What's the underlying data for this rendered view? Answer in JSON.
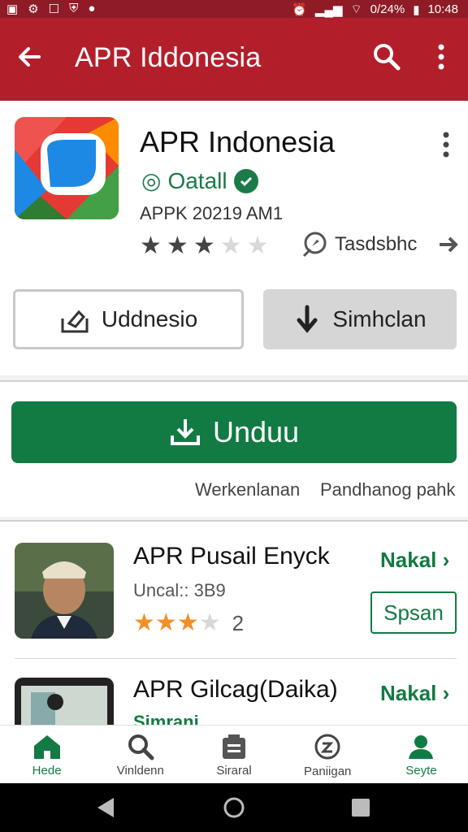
{
  "status_bar": {
    "time": "10:48",
    "battery": "0/24%"
  },
  "app_bar": {
    "title": "APR Iddonesia"
  },
  "app_card": {
    "name": "APR Indonesia",
    "developer": "Oatall",
    "meta": "APPK 20219 AM1",
    "rating": 3,
    "rating_max": 5,
    "tag_label": "Tasdsbhc",
    "button_outline": "Uddnesio",
    "button_grey": "Simhclan"
  },
  "install": {
    "label": "Unduu",
    "link_left": "Werkenlanan",
    "link_right": "Pandhanog pahk"
  },
  "list": [
    {
      "title": "APR Pusail Enyck",
      "action": "Nakal",
      "sub": "Uncal:: 3B9",
      "rating": 3,
      "count": "2",
      "button": "Spsan"
    },
    {
      "title": "APR Gilcag(Daika)",
      "action": "Nakal",
      "sub": "Simrani"
    }
  ],
  "bottom_nav": [
    {
      "label": "Hede",
      "icon": "home-icon",
      "active": true
    },
    {
      "label": "Vinldenn",
      "icon": "search-icon",
      "active": false
    },
    {
      "label": "Siraral",
      "icon": "apps-icon",
      "active": false
    },
    {
      "label": "Paniigan",
      "icon": "refresh-icon",
      "active": false
    },
    {
      "label": "Seyte",
      "icon": "person-icon",
      "active": true
    }
  ],
  "colors": {
    "appbar": "#b21f2b",
    "green": "#127a43",
    "star_dark": "#444444",
    "star_orange": "#f0902a"
  }
}
